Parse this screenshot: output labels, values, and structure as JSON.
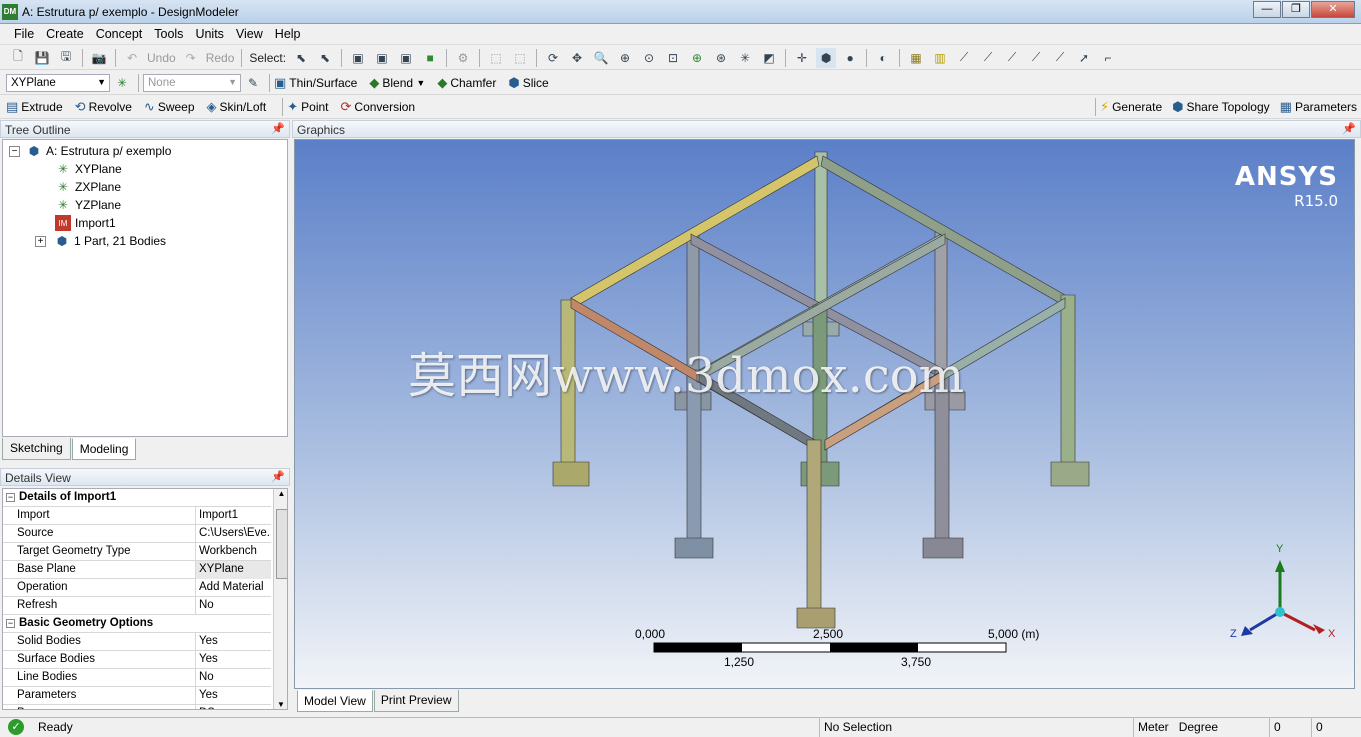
{
  "window": {
    "title": "A: Estrutura p/ exemplo - DesignModeler",
    "app_icon": "DM"
  },
  "menu": [
    "File",
    "Create",
    "Concept",
    "Tools",
    "Units",
    "View",
    "Help"
  ],
  "toolbar1": {
    "undo": "Undo",
    "redo": "Redo",
    "select": "Select:"
  },
  "toolbar2": {
    "plane_value": "XYPlane",
    "sketch_value": "None",
    "thin_surface": "Thin/Surface",
    "blend": "Blend",
    "chamfer": "Chamfer",
    "slice": "Slice"
  },
  "toolbar3": {
    "extrude": "Extrude",
    "revolve": "Revolve",
    "sweep": "Sweep",
    "skin_loft": "Skin/Loft",
    "point": "Point",
    "conversion": "Conversion",
    "generate": "Generate",
    "share_topology": "Share Topology",
    "parameters": "Parameters"
  },
  "tree": {
    "header": "Tree Outline",
    "root": "A: Estrutura p/ exemplo",
    "items": [
      "XYPlane",
      "ZXPlane",
      "YZPlane",
      "Import1",
      "1 Part, 21 Bodies"
    ]
  },
  "left_tabs": [
    "Sketching",
    "Modeling"
  ],
  "details": {
    "header": "Details View",
    "rows": [
      {
        "type": "group",
        "key": "Details of Import1"
      },
      {
        "key": "Import",
        "value": "Import1"
      },
      {
        "key": "Source",
        "value": "C:\\Users\\Eve..."
      },
      {
        "key": "Target Geometry Type",
        "value": "Workbench"
      },
      {
        "key": "Base Plane",
        "value": "XYPlane"
      },
      {
        "key": "Operation",
        "value": "Add Material"
      },
      {
        "key": "Refresh",
        "value": "No"
      },
      {
        "type": "group",
        "key": "Basic Geometry Options"
      },
      {
        "key": "Solid Bodies",
        "value": "Yes"
      },
      {
        "key": "Surface Bodies",
        "value": "Yes"
      },
      {
        "key": "Line Bodies",
        "value": "No"
      },
      {
        "key": "Parameters",
        "value": "Yes"
      },
      {
        "key": "Pa...",
        "value": "DS"
      }
    ]
  },
  "graphics": {
    "header": "Graphics",
    "brand": "ANSYS",
    "version": "R15.0",
    "watermark": "莫西网www.3dmox.com",
    "scale": {
      "labels_top": [
        "0,000",
        "2,500",
        "5,000 (m)"
      ],
      "labels_bottom": [
        "1,250",
        "3,750"
      ]
    },
    "axes": {
      "x": "X",
      "y": "Y",
      "z": "Z"
    }
  },
  "graphics_tabs": [
    "Model View",
    "Print Preview"
  ],
  "status": {
    "ready": "Ready",
    "selection": "No Selection",
    "units_length": "Meter",
    "units_angle": "Degree",
    "val1": "0",
    "val2": "0"
  }
}
